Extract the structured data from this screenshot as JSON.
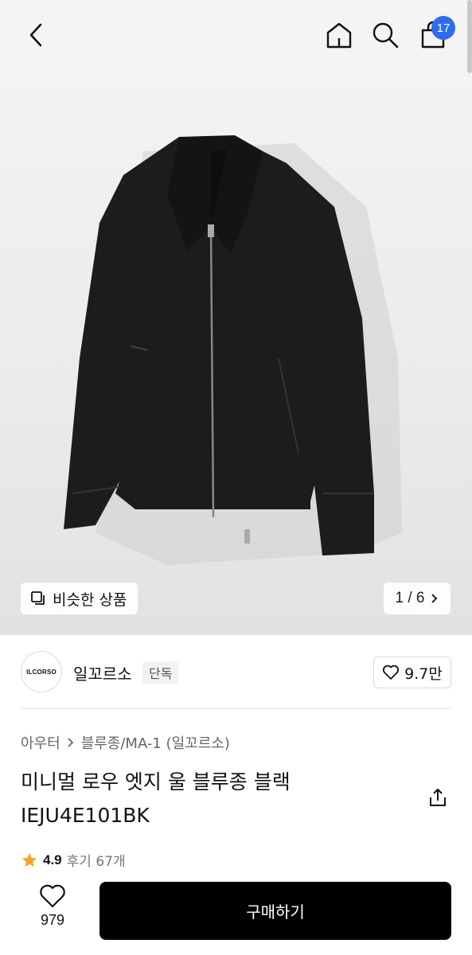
{
  "header": {
    "cart_count": "17"
  },
  "hero": {
    "similar_label": "비슷한 상품",
    "pager": "1 / 6"
  },
  "brand": {
    "logo_text": "ILCORSO",
    "name": "일꼬르소",
    "tag": "단독",
    "likes": "9.7만"
  },
  "breadcrumb": {
    "category": "아우터",
    "subcategory": "블루종/MA-1 (일꼬르소)"
  },
  "product": {
    "title": "미니멀 로우 엣지 울 블루종 블랙 IEJU4E101BK",
    "rating": "4.9",
    "reviews": "후기 67개"
  },
  "bottom": {
    "wish_count": "979",
    "buy_label": "구매하기"
  },
  "colors": {
    "accent": "#2d6cf0",
    "star": "#f5a623",
    "buy_bg": "#000000"
  }
}
